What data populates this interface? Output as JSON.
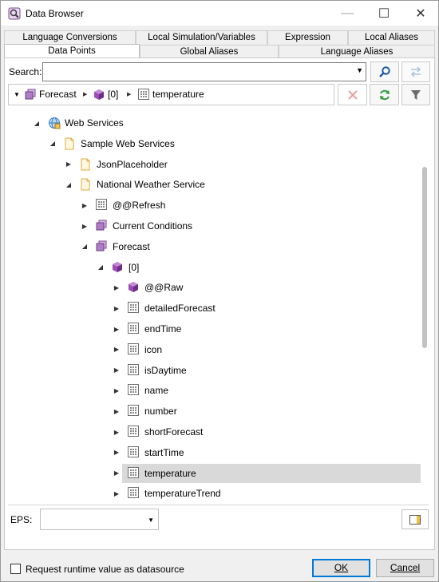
{
  "window": {
    "title": "Data Browser",
    "minimize_glyph": "—",
    "maximize_glyph": "☐",
    "close_glyph": "✕"
  },
  "tabs_top": [
    {
      "label": "Language Conversions"
    },
    {
      "label": "Local Simulation/Variables"
    },
    {
      "label": "Expression"
    },
    {
      "label": "Local Aliases"
    }
  ],
  "tabs_bottom": [
    {
      "label": "Data Points",
      "active": true
    },
    {
      "label": "Global Aliases"
    },
    {
      "label": "Language Aliases"
    }
  ],
  "search": {
    "label": "Search:",
    "value": "",
    "placeholder": ""
  },
  "toolbar_icons": {
    "search": "search-icon",
    "swap": "swap-arrows-icon",
    "clear": "clear-x-icon",
    "refresh": "refresh-icon",
    "filter": "filter-icon"
  },
  "breadcrumb": [
    {
      "label": "Forecast",
      "icon": "object-list-icon"
    },
    {
      "label": "[0]",
      "icon": "cube-icon"
    },
    {
      "label": "temperature",
      "icon": "value-field-icon"
    }
  ],
  "tree": [
    {
      "label": "Web Services",
      "icon": "web-services-icon",
      "expanded": true
    },
    {
      "label": "Sample Web Services",
      "icon": "document-icon",
      "expanded": true
    },
    {
      "label": "JsonPlaceholder",
      "icon": "document-icon",
      "expanded": false
    },
    {
      "label": "National Weather Service",
      "icon": "document-icon",
      "expanded": true
    },
    {
      "label": "@@Refresh",
      "icon": "value-field-icon",
      "expanded": false
    },
    {
      "label": "Current Conditions",
      "icon": "object-list-icon",
      "expanded": false
    },
    {
      "label": "Forecast",
      "icon": "object-list-icon",
      "expanded": true
    },
    {
      "label": "[0]",
      "icon": "cube-icon",
      "expanded": true
    },
    {
      "label": "@@Raw",
      "icon": "cube-icon",
      "expanded": false
    },
    {
      "label": "detailedForecast",
      "icon": "value-field-icon",
      "expanded": false
    },
    {
      "label": "endTime",
      "icon": "value-field-icon",
      "expanded": false
    },
    {
      "label": "icon",
      "icon": "value-field-icon",
      "expanded": false
    },
    {
      "label": "isDaytime",
      "icon": "value-field-icon",
      "expanded": false
    },
    {
      "label": "name",
      "icon": "value-field-icon",
      "expanded": false
    },
    {
      "label": "number",
      "icon": "value-field-icon",
      "expanded": false
    },
    {
      "label": "shortForecast",
      "icon": "value-field-icon",
      "expanded": false
    },
    {
      "label": "startTime",
      "icon": "value-field-icon",
      "expanded": false
    },
    {
      "label": "temperature",
      "icon": "value-field-icon",
      "expanded": false,
      "selected": true
    },
    {
      "label": "temperatureTrend",
      "icon": "value-field-icon",
      "expanded": false
    }
  ],
  "eps": {
    "label": "EPS:",
    "value": ""
  },
  "footer": {
    "checkbox_label": "Request runtime value as datasource",
    "checkbox_checked": false,
    "ok_label": "OK",
    "cancel_label": "Cancel"
  },
  "colors": {
    "accent": "#0078d7",
    "selected_row": "#d9d9d9",
    "search_icon": "#1e5aa8",
    "refresh_icon": "#2e9b3a",
    "clear_icon": "#e8a0a0"
  }
}
